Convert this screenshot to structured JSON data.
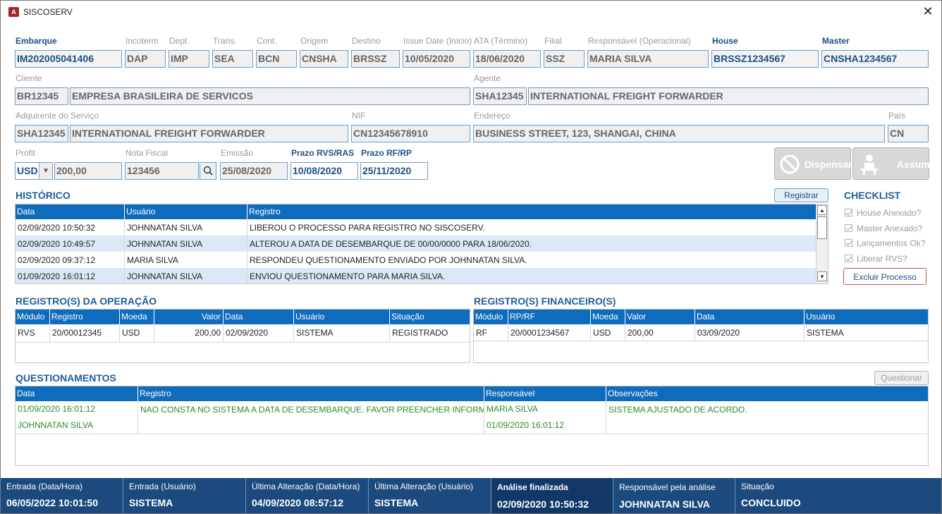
{
  "window": {
    "title": "SISCOSERV",
    "icon_text": "A",
    "close_glyph": "✕"
  },
  "header_fields": {
    "embarque": {
      "label": "Embarque",
      "value": "IM202005041406"
    },
    "incoterm": {
      "label": "Incoterm",
      "value": "DAP"
    },
    "dept": {
      "label": "Dept.",
      "value": "IMP"
    },
    "trans": {
      "label": "Trans.",
      "value": "SEA"
    },
    "cont": {
      "label": "Cont.",
      "value": "BCN"
    },
    "origem": {
      "label": "Origem",
      "value": "CNSHA"
    },
    "destino": {
      "label": "Destino",
      "value": "BRSSZ"
    },
    "issue_date": {
      "label": "Issue Date (Início)",
      "value": "10/05/2020"
    },
    "ata": {
      "label": "ATA (Término)",
      "value": "18/06/2020"
    },
    "filial": {
      "label": "Filial",
      "value": "SSZ"
    },
    "responsavel": {
      "label": "Responsável (Operacional)",
      "value": "MARIA SILVA"
    },
    "house": {
      "label": "House",
      "value": "BRSSZ1234567"
    },
    "master": {
      "label": "Master",
      "value": "CNSHA1234567"
    }
  },
  "cliente": {
    "label": "Cliente",
    "code": "BR12345",
    "name": "EMPRESA BRASILEIRA DE SERVICOS"
  },
  "agente": {
    "label": "Agente",
    "code": "SHA12345",
    "name": "INTERNATIONAL FREIGHT FORWARDER"
  },
  "adquirente": {
    "label": "Adquirente do Serviço",
    "code": "SHA12345",
    "name": "INTERNATIONAL FREIGHT FORWARDER"
  },
  "nif": {
    "label": "NIF",
    "value": "CN12345678910"
  },
  "endereco": {
    "label": "Endereço",
    "value": "BUSINESS STREET, 123, SHANGAI, CHINA"
  },
  "pais": {
    "label": "País",
    "value": "CN"
  },
  "profit": {
    "label": "Profit",
    "currency": "USD",
    "value": "200,00"
  },
  "nota_fiscal": {
    "label": "Nota Fiscal",
    "value": "123456"
  },
  "emissao": {
    "label": "Emissão",
    "value": "25/08/2020"
  },
  "prazo_rvs": {
    "label": "Prazo RVS/RAS",
    "value": "10/08/2020"
  },
  "prazo_rf": {
    "label": "Prazo RF/RP",
    "value": "25/11/2020"
  },
  "actions": {
    "dispensar": "Dispensar",
    "assumir": "Assumir"
  },
  "historico": {
    "title": "HISTÓRICO",
    "register_button": "Registrar",
    "columns": [
      "Data",
      "Usuário",
      "Registro"
    ],
    "rows": [
      [
        "02/09/2020 10:50:32",
        "JOHNNATAN SILVA",
        "LIBEROU O PROCESSO PARA REGISTRO NO SISCOSERV."
      ],
      [
        "02/09/2020 10:49:57",
        "JOHNNATAN SILVA",
        "ALTEROU A DATA DE DESEMBARQUE DE 00/00/0000 PARA 18/06/2020."
      ],
      [
        "02/09/2020 09:37:12",
        "MARIA SILVA",
        "RESPONDEU QUESTIONAMENTO ENVIADO POR JOHNNATAN SILVA."
      ],
      [
        "01/09/2020 16:01:12",
        "JOHNNATAN SILVA",
        "ENVIOU QUESTIONAMENTO PARA MARIA SILVA."
      ]
    ]
  },
  "checklist": {
    "title": "CHECKLIST",
    "items": [
      "House Anexado?",
      "Master Anexado?",
      "Lançamentos Ok?",
      "Liberar RVS?"
    ],
    "delete_button": "Excluir Processo"
  },
  "operacao": {
    "title": "REGISTRO(S) DA OPERAÇÃO",
    "columns": [
      "Módulo",
      "Registro",
      "Moeda",
      "Valor",
      "Data",
      "Usuário",
      "Situação"
    ],
    "rows": [
      [
        "RVS",
        "20/00012345",
        "USD",
        "200,00",
        "02/09/2020",
        "SISTEMA",
        "REGISTRADO"
      ]
    ]
  },
  "financeiro": {
    "title": "REGISTRO(S) FINANCEIRO(S)",
    "columns": [
      "Módulo",
      "RP/RF",
      "Moeda",
      "Valor",
      "Data",
      "Usuário"
    ],
    "rows": [
      [
        "RF",
        "20/0001234567",
        "USD",
        "200,00",
        "03/09/2020",
        "SISTEMA"
      ]
    ]
  },
  "questionamentos": {
    "title": "QUESTIONAMENTOS",
    "button": "Questionar",
    "columns": [
      "Data",
      "Registro",
      "Responsável",
      "Observações"
    ],
    "row": {
      "data": "01/09/2020 16:01:12",
      "usuario": "JOHNNATAN SILVA",
      "registro": "NAO CONSTA NO SISTEMA A DATA DE DESEMBARQUE. FAVOR PREENCHER INFORMACAO.",
      "responsavel": "MARIA SILVA",
      "resp_data": "01/09/2020 16:01:12",
      "observacoes": "SISTEMA AJUSTADO DE ACORDO."
    }
  },
  "footer": [
    {
      "label": "Entrada (Data/Hora)",
      "value": "06/05/2022 10:01:50"
    },
    {
      "label": "Entrada (Usuário)",
      "value": "SISTEMA"
    },
    {
      "label": "Última Alteração (Data/Hora)",
      "value": "04/09/2020 08:57:12"
    },
    {
      "label": "Última Alteração (Usuário)",
      "value": "SISTEMA"
    },
    {
      "label": "Análise finalizada",
      "value": "02/09/2020 10:50:32"
    },
    {
      "label": "Responsável pela análise",
      "value": "JOHNNATAN SILVA"
    },
    {
      "label": "Situação",
      "value": "CONCLUIDO"
    }
  ],
  "colors": {
    "accent": "#0f6cbd",
    "section": "#1e5c9b",
    "footer": "#1d4a7e",
    "question_text": "#2c8a2c",
    "delete_border": "#c0504d"
  }
}
